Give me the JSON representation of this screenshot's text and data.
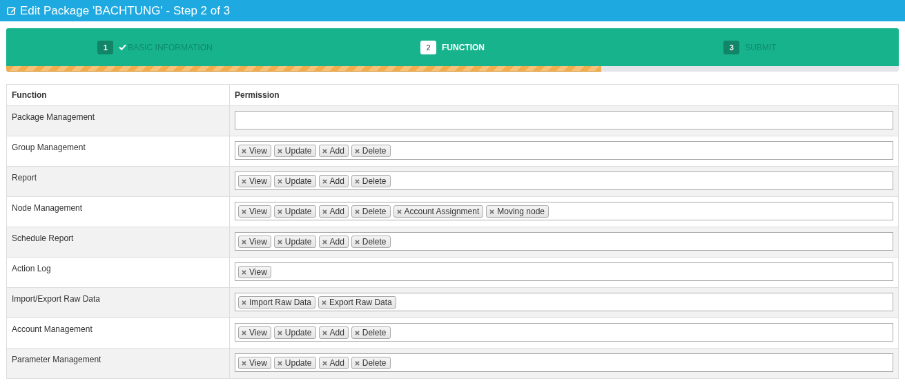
{
  "window": {
    "title": "Edit Package 'BACHTUNG' - Step 2 of 3"
  },
  "wizard": {
    "steps": [
      {
        "number": "1",
        "label": "BASIC INFORMATION",
        "completed": true,
        "selected": false
      },
      {
        "number": "2",
        "label": "FUNCTION",
        "completed": false,
        "selected": true
      },
      {
        "number": "3",
        "label": "SUBMIT",
        "completed": false,
        "selected": false
      }
    ],
    "progress": {
      "level": 0.667
    }
  },
  "table": {
    "columns": [
      "Function",
      "Permission"
    ],
    "rows": [
      {
        "function": "Package Management",
        "permissions": []
      },
      {
        "function": "Group Management",
        "permissions": [
          "View",
          "Update",
          "Add",
          "Delete"
        ]
      },
      {
        "function": "Report",
        "permissions": [
          "View",
          "Update",
          "Add",
          "Delete"
        ]
      },
      {
        "function": "Node Management",
        "permissions": [
          "View",
          "Update",
          "Add",
          "Delete",
          "Account Assignment",
          "Moving node"
        ]
      },
      {
        "function": "Schedule Report",
        "permissions": [
          "View",
          "Update",
          "Add",
          "Delete"
        ]
      },
      {
        "function": "Action Log",
        "permissions": [
          "View"
        ]
      },
      {
        "function": "Import/Export Raw Data",
        "permissions": [
          "Import Raw Data",
          "Export Raw Data"
        ]
      },
      {
        "function": "Account Management",
        "permissions": [
          "View",
          "Update",
          "Add",
          "Delete"
        ]
      },
      {
        "function": "Parameter Management",
        "permissions": [
          "View",
          "Update",
          "Add",
          "Delete"
        ]
      }
    ]
  }
}
